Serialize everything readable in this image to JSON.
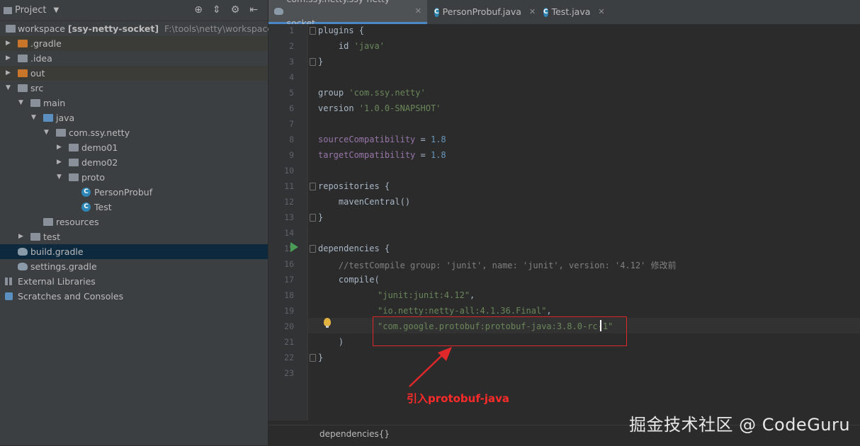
{
  "project_panel": {
    "title": "Project",
    "tree": [
      {
        "label": "workspace",
        "bold_label": "[ssy-netty-socket]",
        "path": "F:\\tools\\netty\\workspace"
      },
      {
        "label": ".gradle"
      },
      {
        "label": ".idea"
      },
      {
        "label": "out"
      },
      {
        "label": "src"
      },
      {
        "label": "main"
      },
      {
        "label": "java"
      },
      {
        "label": "com.ssy.netty"
      },
      {
        "label": "demo01"
      },
      {
        "label": "demo02"
      },
      {
        "label": "proto"
      },
      {
        "label": "PersonProbuf"
      },
      {
        "label": "Test"
      },
      {
        "label": "resources"
      },
      {
        "label": "test"
      },
      {
        "label": "build.gradle"
      },
      {
        "label": "settings.gradle"
      },
      {
        "label": "External Libraries"
      },
      {
        "label": "Scratches and Consoles"
      }
    ]
  },
  "tabs": [
    {
      "label": "com.ssy.netty.ssy-netty-socket",
      "active": true
    },
    {
      "label": "PersonProbuf.java",
      "active": false
    },
    {
      "label": "Test.java",
      "active": false
    }
  ],
  "editor": {
    "line_numbers": [
      "1",
      "2",
      "3",
      "4",
      "5",
      "6",
      "7",
      "8",
      "9",
      "10",
      "11",
      "12",
      "13",
      "14",
      "15",
      "16",
      "17",
      "18",
      "19",
      "20",
      "21",
      "22",
      "23"
    ],
    "lines": {
      "l1": "plugins {",
      "l2_kw": "id ",
      "l2_str": "'java'",
      "l3": "}",
      "l5_kw": "group ",
      "l5_str": "'com.ssy.netty'",
      "l6_kw": "version ",
      "l6_str": "'1.0.0-SNAPSHOT'",
      "l8_prop": "sourceCompatibility",
      "l8_op": " = ",
      "l8_num": "1.8",
      "l9_prop": "targetCompatibility",
      "l9_op": " = ",
      "l9_num": "1.8",
      "l11": "repositories {",
      "l12": "    mavenCentral()",
      "l13": "}",
      "l15": "dependencies {",
      "l16": "    //testCompile group: 'junit', name: 'junit', version: '4.12' 修改前",
      "l17": "    compile(",
      "l18": "\"junit:junit:4.12\"",
      "l18_comma": ",",
      "l19": "\"io.netty:netty-all:4.1.36.Final\"",
      "l19_comma": ",",
      "l20": "\"com.google.protobuf:protobuf-java:3.8.0-rc-1\"",
      "l21": "    )",
      "l22": "}"
    }
  },
  "annotation": "引入protobuf-java",
  "breadcrumb": "dependencies{}",
  "watermark": "掘金技术社区 @ CodeGuru",
  "colors": {
    "accent": "#4a88c7",
    "annotation": "#e0282a",
    "string": "#6a8759",
    "number": "#6897bb"
  }
}
